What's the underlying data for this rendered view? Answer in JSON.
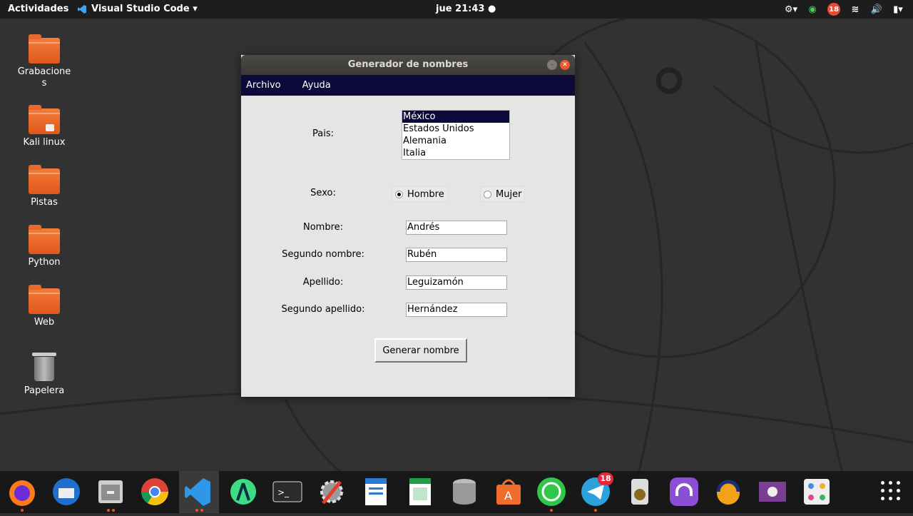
{
  "topbar": {
    "activities": "Actividades",
    "app_name": "Visual Studio Code ▾",
    "clock": "jue 21:43 ●",
    "notification_count": "18"
  },
  "desktop": {
    "items": [
      {
        "label": "Grabacione\ns",
        "icon": "folder-icon"
      },
      {
        "label": "Kali linux",
        "icon": "locked-folder-icon"
      },
      {
        "label": "Pistas",
        "icon": "folder-icon"
      },
      {
        "label": "Python",
        "icon": "folder-icon"
      },
      {
        "label": "Web",
        "icon": "folder-icon"
      },
      {
        "label": "Papelera",
        "icon": "trash-icon"
      }
    ]
  },
  "window": {
    "title": "Generador de nombres",
    "menu": [
      "Archivo",
      "Ayuda"
    ],
    "pais_label": "Pais:",
    "countries": [
      "México",
      "Estados Unidos",
      "Alemania",
      "Italia"
    ],
    "selected_country": "México",
    "sexo_label": "Sexo:",
    "radio_hombre": "Hombre",
    "radio_mujer": "Mujer",
    "selected_sex": "Hombre",
    "nombre_label": "Nombre:",
    "nombre_value": "Andrés",
    "segundo_nombre_label": "Segundo nombre:",
    "segundo_nombre_value": "Rubén",
    "apellido_label": "Apellido:",
    "apellido_value": "Leguizamón",
    "segundo_apellido_label": "Segundo apellido:",
    "segundo_apellido_value": "Hernández",
    "button_label": "Generar nombre"
  },
  "dock": {
    "apps": [
      "firefox-icon",
      "thunderbird-icon",
      "files-icon",
      "chrome-icon",
      "vscode-icon",
      "android-studio-icon",
      "terminal-icon",
      "settings-tools-icon",
      "writer-icon",
      "calc-icon",
      "database-icon",
      "software-center-icon",
      "whatsapp-icon",
      "telegram-icon",
      "speaker-icon",
      "headphones-icon",
      "audacity-icon",
      "video-icon",
      "apps-icon"
    ],
    "telegram_badge": "18"
  }
}
